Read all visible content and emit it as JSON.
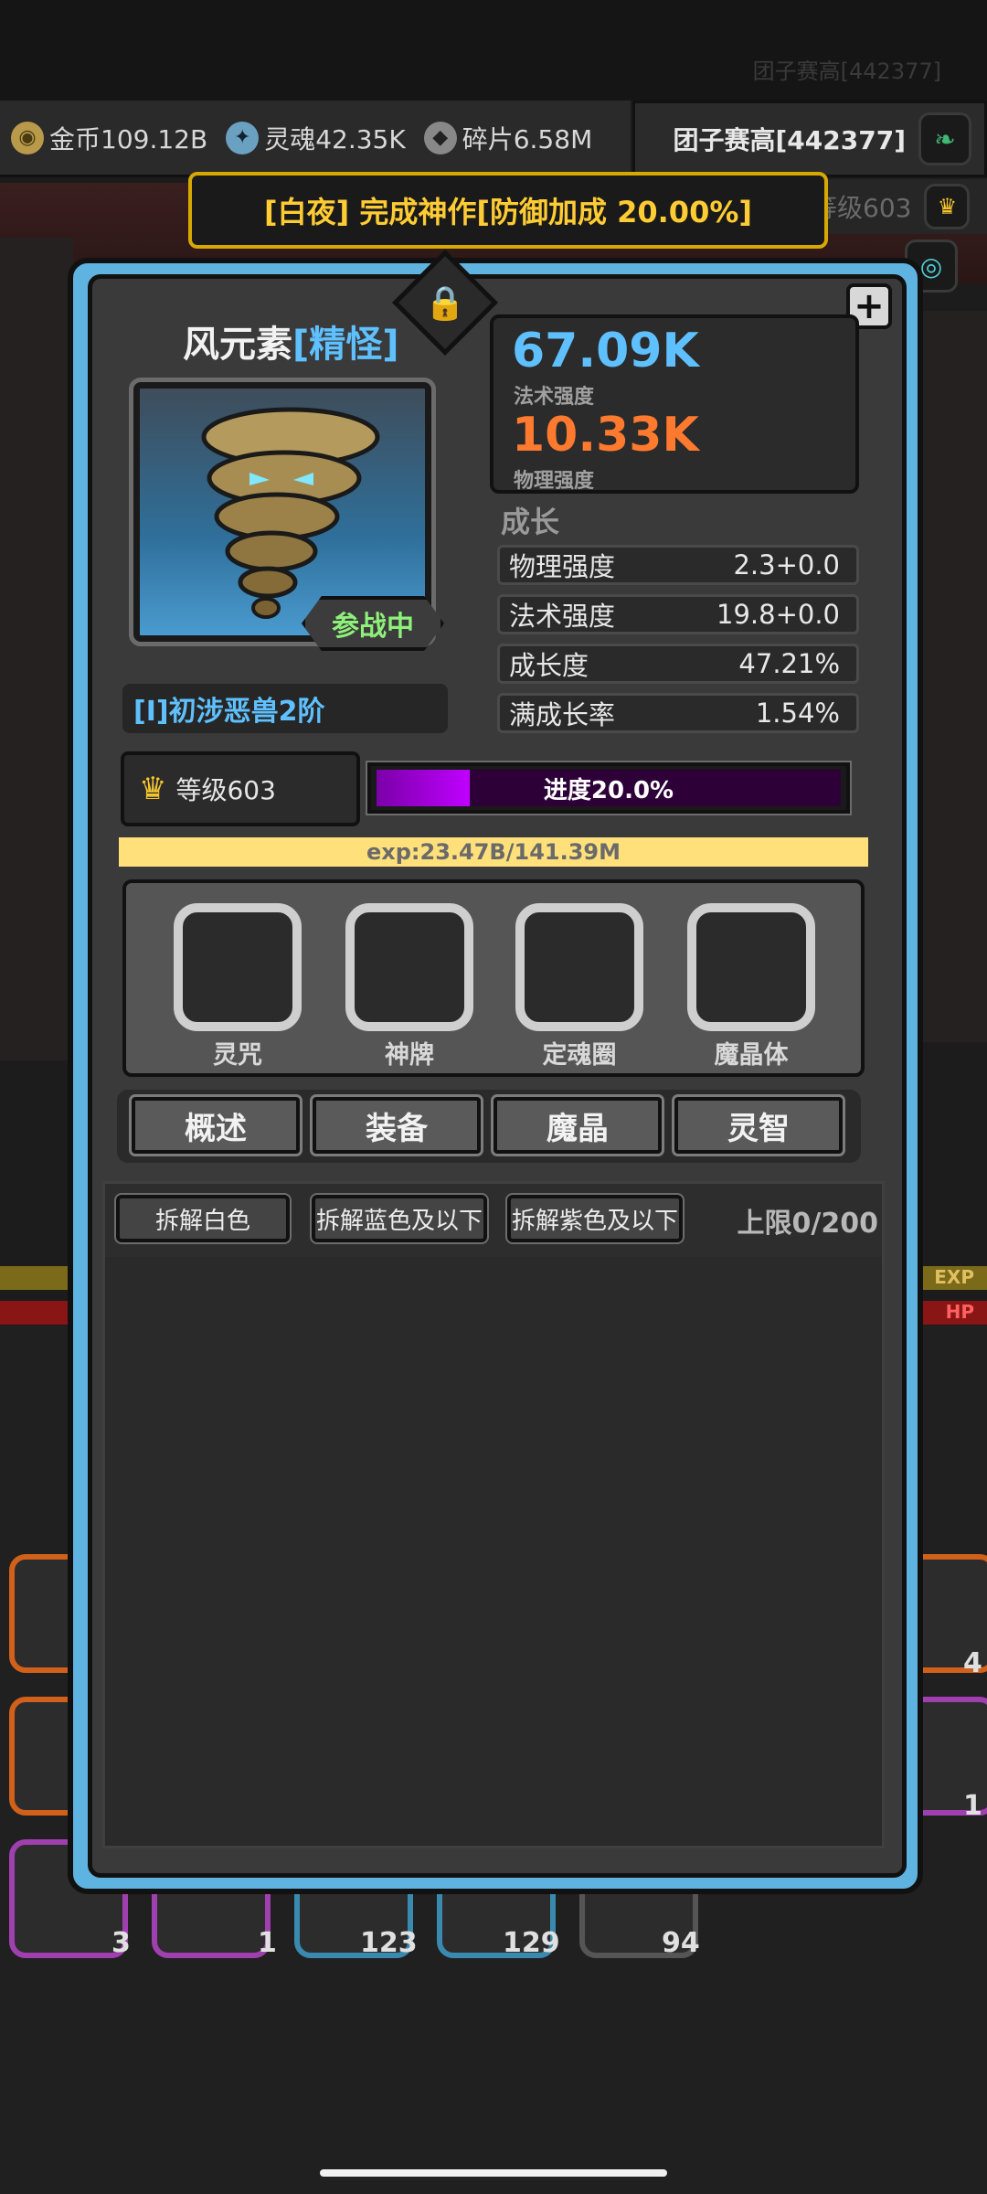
{
  "background": {
    "ghost_player": "团子赛高[442377]",
    "currencies": [
      {
        "icon": "gold-coin-icon",
        "label": "金币109.12B"
      },
      {
        "icon": "soul-icon",
        "label": "灵魂42.35K"
      },
      {
        "icon": "shard-icon",
        "label": "碎片6.58M"
      }
    ],
    "player_name": "团子赛高[442377]",
    "level_label": "等级603",
    "exp_label": "EXP",
    "hp_label": "HP",
    "stack_counts": [
      "3",
      "1",
      "123",
      "129",
      "94",
      "4",
      "1"
    ]
  },
  "toast": {
    "text": "[白夜] 完成神作[防御加成 20.00%]"
  },
  "monster": {
    "name": "风元素",
    "rarity": "[精怪]",
    "deploy_badge": "参战中",
    "tier": "[I]初涉恶兽2阶",
    "magic_power": "67.09K",
    "magic_power_label": "法术强度",
    "physical_power": "10.33K",
    "physical_power_label": "物理强度",
    "growth_title": "成长",
    "growth_stats": [
      {
        "label": "物理强度",
        "value": "2.3+0.0"
      },
      {
        "label": "法术强度",
        "value": "19.8+0.0"
      },
      {
        "label": "成长度",
        "value": "47.21%"
      },
      {
        "label": "满成长率",
        "value": "1.54%"
      }
    ],
    "level": "等级603",
    "progress_label": "进度20.0%",
    "progress": 0.2,
    "exp_text": "exp:23.47B/141.39M"
  },
  "slots": [
    {
      "label": "灵咒"
    },
    {
      "label": "神牌"
    },
    {
      "label": "定魂圈"
    },
    {
      "label": "魔晶体"
    }
  ],
  "tabs": [
    {
      "label": "概述"
    },
    {
      "label": "装备"
    },
    {
      "label": "魔晶"
    },
    {
      "label": "灵智"
    }
  ],
  "inventory": {
    "buttons": [
      {
        "label": "拆解白色"
      },
      {
        "label": "拆解蓝色及以下"
      },
      {
        "label": "拆解紫色及以下"
      }
    ],
    "capacity": "上限0/200"
  },
  "colors": {
    "modal_border": "#5fb3e0",
    "magic": "#5fc0ff",
    "physical": "#ff7a2f",
    "toast": "#ffcc33",
    "progress": "#c000ff",
    "deploy": "#8ef07a"
  }
}
